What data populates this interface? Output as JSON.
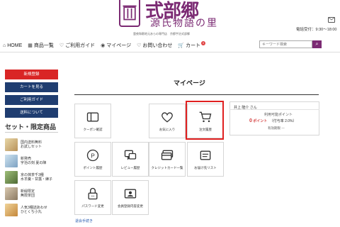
{
  "header": {
    "logo_title": "式部郷",
    "logo_sub": "源氏物語の里",
    "tagline": "霊夜和歌地元あらの専門店　京都宇治式部郷",
    "phone_hours": "電話受付：9:30～18:00"
  },
  "nav": {
    "items": [
      {
        "icon": "home-icon",
        "label": "HOME"
      },
      {
        "icon": "product-list-icon",
        "label": "商品一覧"
      },
      {
        "icon": "heart-icon",
        "label": "ご利用ガイド"
      },
      {
        "icon": "user-icon",
        "label": "マイページ"
      },
      {
        "icon": "heart-icon",
        "label": "お問い合わせ"
      },
      {
        "icon": "cart-icon",
        "label": "カート",
        "badge": "0"
      }
    ],
    "search_placeholder": "キーワード検索"
  },
  "sidebar": {
    "buttons": [
      {
        "label": "新規登録",
        "color": "#d92525"
      },
      {
        "label": "カートを見る",
        "color": "#1f3d70"
      },
      {
        "label": "ご利用ガイド",
        "color": "#1f3d70"
      },
      {
        "label": "送料について",
        "color": "#1f3d70"
      }
    ],
    "heading": "セット・限定商品",
    "products": [
      {
        "line1": "国内送料無料",
        "line2": "お試しセット"
      },
      {
        "line1": "新発売",
        "line2": "宇治の刻 夏の陣"
      },
      {
        "line1": "京の抹茶千3種",
        "line2": "水羊羹・甘露・練子"
      },
      {
        "line1": "新緑限定",
        "line2": "無限茶団"
      },
      {
        "line1": "人気3種詰あわせ",
        "line2": "ひとくち小丸"
      }
    ]
  },
  "main": {
    "title": "マイページ",
    "tiles": [
      {
        "label": "クーポン確認",
        "icon": "coupon-icon"
      },
      {
        "label": "お気に入り",
        "icon": "heart-icon"
      },
      {
        "label": "注文履歴",
        "icon": "cart-icon"
      },
      {
        "label": "ポイント履歴",
        "icon": "points-icon"
      },
      {
        "label": "レビュー履歴",
        "icon": "review-icon"
      },
      {
        "label": "クレジットカード一覧",
        "icon": "credit-card-icon"
      },
      {
        "label": "お届け先リスト",
        "icon": "address-list-icon"
      },
      {
        "label": "パスワード変更",
        "icon": "lock-icon"
      },
      {
        "label": "会員登録内容変更",
        "icon": "profile-edit-icon"
      }
    ],
    "account": {
      "name": "井上 隆介 さん",
      "points_label": "利用可能ポイント",
      "points_value": "0",
      "points_unit": "ポイント",
      "points_rate": "（付与率 2.0%）",
      "expiry": "有効期限 ---"
    },
    "footer_link": "退会手続き"
  },
  "colors": {
    "brand": "#7b2a73",
    "highlight": "#e02020",
    "sidebar_red": "#d92525",
    "sidebar_navy": "#1f3d70",
    "points": "#d43d3d"
  }
}
